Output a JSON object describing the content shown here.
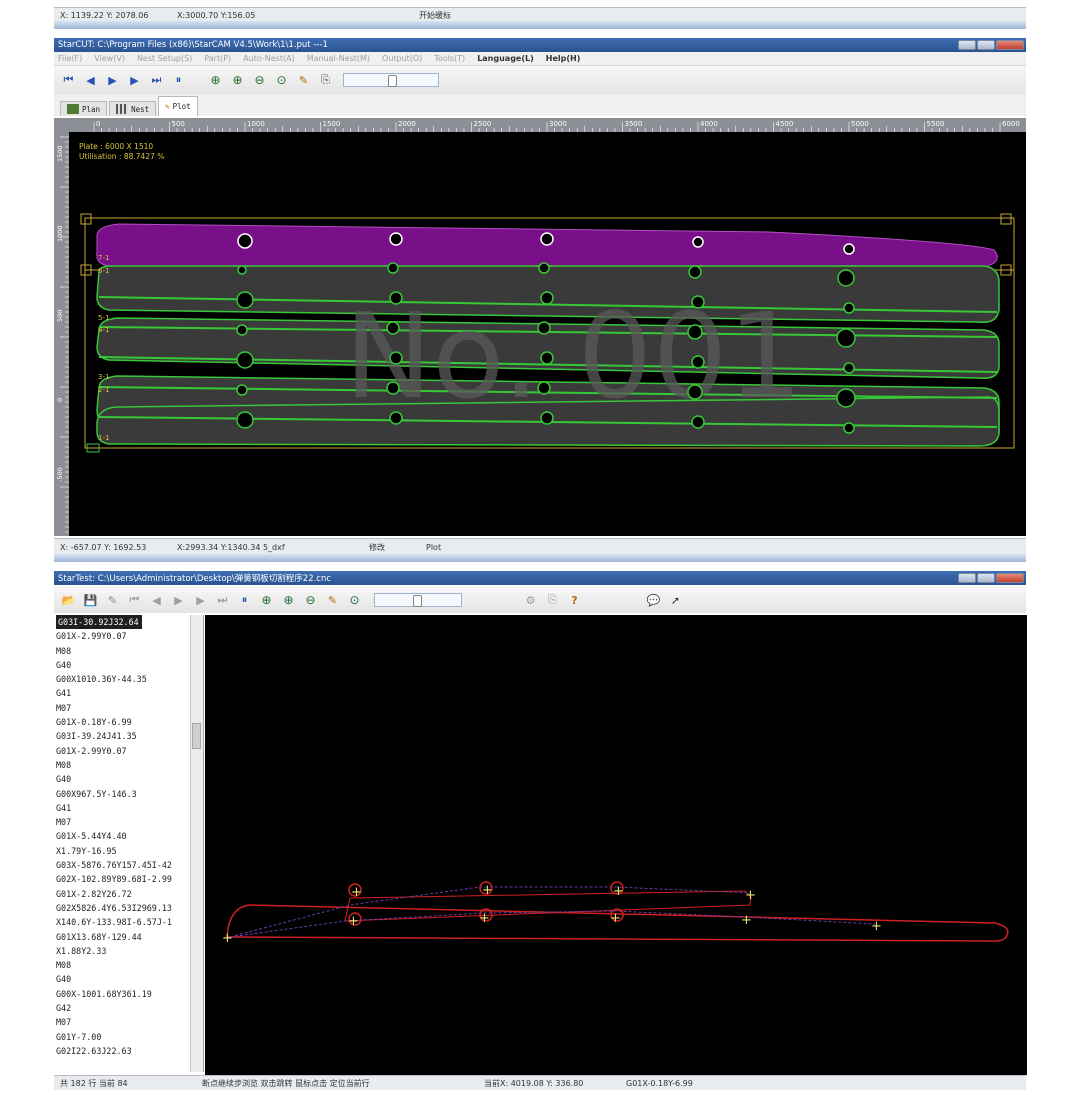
{
  "top_status": {
    "coord1": "X: 1139.22  Y: 2078.06",
    "coord2": "X:3000.70 Y:156.05",
    "label": "开始缓标"
  },
  "starcut": {
    "title": "StarCUT: C:\\Program Files (x86)\\StarCAM V4.5\\Work\\1\\1.put  ---1",
    "menus": [
      "File(F)",
      "View(V)",
      "Nest Setup(S)",
      "Part(P)",
      "Auto-Nest(A)",
      "Manual-Nest(M)",
      "Output(O)",
      "Tools(T)",
      "Language(L)",
      "Help(H)"
    ],
    "tabs": [
      "Plan",
      "Nest",
      "Plot"
    ],
    "ruler_labels": [
      "0",
      "500",
      "1000",
      "1500",
      "2000",
      "2500",
      "3000",
      "3500",
      "4000",
      "4500",
      "5000",
      "5500",
      "6000"
    ],
    "left_ruler_labels": [
      "1500",
      "1000",
      "500",
      "0",
      "-500"
    ],
    "plate_line1": "Plate : 6000 X 1510",
    "plate_line2": "Utilisation : 88.7427 %",
    "watermark": "No. 001",
    "part_labels": [
      "7-1",
      "6-1",
      "5-1",
      "4-1",
      "3-1",
      "2-1",
      "1-1"
    ],
    "status": {
      "coord1": "X: -657.07  Y: 1692.53",
      "coord2": "X:2993.34 Y:1340.34  5_dxf",
      "label1": "修改",
      "label2": "Plot"
    },
    "colors": {
      "purple": "#7a0f8a",
      "green": "#37c837",
      "frame": "#c8a838",
      "plate": "#3a3a3a",
      "bg": "#000000"
    }
  },
  "startest": {
    "title": "StarTest: C:\\Users\\Administrator\\Desktop\\弹簧钢板切割程序22.cnc",
    "code_lines": [
      "G03I-30.92J32.64",
      "G01X-2.99Y0.07",
      "M08",
      "G40",
      "G00X1010.36Y-44.35",
      "G41",
      "M07",
      "G01X-0.18Y-6.99",
      "G03I-39.24J41.35",
      "G01X-2.99Y0.07",
      "M08",
      "G40",
      "G00X967.5Y-146.3",
      "G41",
      "M07",
      "G01X-5.44Y4.40",
      "X1.79Y-16.95",
      "G03X-5876.76Y157.45I-42",
      "G02X-102.89Y89.68I-2.99",
      "G01X-2.82Y26.72",
      "G02X5826.4Y6.53I2969.13",
      "X140.6Y-133.98I-6.57J-1",
      "G01X13.68Y-129.44",
      "X1.88Y2.33",
      "M08",
      "G40",
      "G00X-1001.68Y361.19",
      "G42",
      "M07",
      "G01Y-7.00",
      "G02I22.63J22.63"
    ],
    "status": {
      "lines": "共 182 行  当前 84",
      "hint": "断点继续步浏览  双击跳转  鼠标点击  定位当前行",
      "coords": "当前X: 4019.08  Y: 336.80",
      "current": "G01X-0.18Y-6.99"
    }
  }
}
